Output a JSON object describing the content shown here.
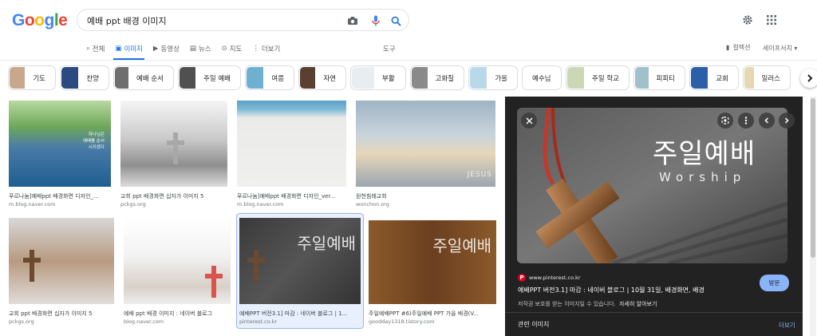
{
  "logo": {
    "text": "Google",
    "letters": [
      {
        "ch": "G",
        "color": "#4285f4"
      },
      {
        "ch": "o",
        "color": "#ea4335"
      },
      {
        "ch": "o",
        "color": "#fbbc05"
      },
      {
        "ch": "g",
        "color": "#4285f4"
      },
      {
        "ch": "l",
        "color": "#34a853"
      },
      {
        "ch": "e",
        "color": "#ea4335"
      }
    ]
  },
  "search": {
    "query": "예배 ppt 배경 이미지"
  },
  "tabs": [
    {
      "label": "전체",
      "icon": "search-icon",
      "active": false
    },
    {
      "label": "이미지",
      "icon": "image-icon",
      "active": true
    },
    {
      "label": "동영상",
      "icon": "video-icon",
      "active": false
    },
    {
      "label": "뉴스",
      "icon": "news-icon",
      "active": false
    },
    {
      "label": "지도",
      "icon": "map-pin-icon",
      "active": false
    },
    {
      "label": "더보기",
      "icon": "more-vert-icon",
      "active": false
    }
  ],
  "tools_label": "도구",
  "collections_label": "컬렉션",
  "safesearch_label": "세이프서치",
  "chips": [
    {
      "label": "기도",
      "color": "#c8a88c"
    },
    {
      "label": "찬양",
      "color": "#2a4a80"
    },
    {
      "label": "예배 순서",
      "color": "#6e6e6e"
    },
    {
      "label": "주일 예배",
      "color": "#505050"
    },
    {
      "label": "여름",
      "color": "#6fb0d0"
    },
    {
      "label": "자연",
      "color": "#5a4030"
    },
    {
      "label": "부활",
      "color": "#e8edf2"
    },
    {
      "label": "고화질",
      "color": "#8a8a8a"
    },
    {
      "label": "가을",
      "color": "#b9d9ea"
    },
    {
      "label": "예수님",
      "color": ""
    },
    {
      "label": "주일 학교",
      "color": "#ccd8b5"
    },
    {
      "label": "피피티",
      "color": "#a0c0cc"
    },
    {
      "label": "교회",
      "color": "#2b5fa8"
    },
    {
      "label": "일러스",
      "color": "#e6d8b0"
    }
  ],
  "results": [
    {
      "title": "푸르나눔]예배ppt 배경화면 디자인_...",
      "source": "m.blog.naver.com",
      "bg": "linear-gradient(180deg,#b8d9a0 0%,#6fa85a 30%,#4a7aa8 55%,#1d5f90 100%)",
      "overlay_text": "하나님은\n예배를 순서\n시키셨다"
    },
    {
      "title": "교회 ppt 배경화면 십자가 이미지 5",
      "source": "pckgs.org",
      "bg": "linear-gradient(180deg,#f5f5f5 0%,#c9c9c9 45%,#8f8f8f 75%,#dcdcdc 100%)",
      "overlay_text": ""
    },
    {
      "title": "푸르나눔]예배ppt 배경화면 디자인_ver...",
      "source": "m.blog.naver.com",
      "bg": "linear-gradient(180deg,#5aa0c8 0%,#7dbad6 10%,#eaeae8 20%,#f0f0ee 100%)",
      "overlay_text": ""
    },
    {
      "title": "원천침례교회",
      "source": "wonchon.org",
      "bg": "linear-gradient(180deg,#9fb4c4 0%,#c8d4dc 40%,#e6d6b8 62%,#9aa6b0 100%)",
      "overlay_text": "JESUS"
    },
    {
      "title": "교회 ppt 배경화면 십자가 이미지 5",
      "source": "pckgs.org",
      "bg": "linear-gradient(180deg,#d8d8d8 0%,#b89a80 50%,#e0dcd8 100%)",
      "overlay_text": ""
    },
    {
      "title": "예배 ppt 배경 이미지 : 네이버 블로그",
      "source": "blog.naver.com",
      "bg": "linear-gradient(180deg,#ffffff 0%,#f2f2f2 45%,#d8d0c8 80%,#eee 100%)",
      "overlay_text": ""
    },
    {
      "title": "예배PPT 버전3.1] 마감 : 네이버 블로그 | 1...",
      "source": "pinterest.co.kr",
      "bg": "linear-gradient(135deg,#3a3a3a 0%,#555 50%,#333 100%)",
      "overlay_text": "주일예배"
    },
    {
      "title": "주일예배PPT #6)주일예배 PPT 가을 배경(V...",
      "source": "goodday1318.tistory.com",
      "bg": "linear-gradient(90deg,#8b5a2b 0%,#6b3f1f 50%,#8b5a2b 100%)",
      "overlay_text": "주일예배"
    }
  ],
  "preview": {
    "main_text": "주일예배",
    "sub_text": "Worship",
    "source": "www.pinterest.co.kr",
    "title": "예배PPT 버전3.1] 마감 : 네이버 블로그 | 10월 31일, 배경화면, 배경",
    "copyright": "저작권 보호를 받는 이미지일 수 있습니다.",
    "learn_more": "자세히 알아보기",
    "visit_label": "방문",
    "related_label": "관련 이미지",
    "more_label": "더보기"
  },
  "colors": {
    "accent": "#1a73e8",
    "panel_bg": "#222222",
    "link_dark": "#8ab4f8"
  }
}
